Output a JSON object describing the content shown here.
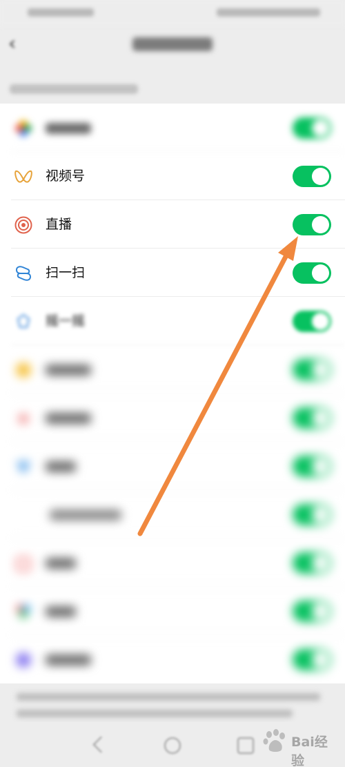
{
  "colors": {
    "toggle_on": "#07c160",
    "arrow": "#f0883e",
    "page_bg": "#ededed",
    "list_bg": "#ffffff"
  },
  "settings_list": [
    {
      "label": "",
      "icon": "moments-icon",
      "enabled": true,
      "blurred": true
    },
    {
      "label": "视频号",
      "icon": "channels-icon",
      "enabled": true,
      "blurred": false
    },
    {
      "label": "直播",
      "icon": "live-icon",
      "enabled": true,
      "blurred": false
    },
    {
      "label": "扫一扫",
      "icon": "scan-icon",
      "enabled": true,
      "blurred": false
    },
    {
      "label": "摇一摇",
      "icon": "shake-icon",
      "enabled": true,
      "blurred": true
    },
    {
      "label": "",
      "icon": "top-stories-icon",
      "enabled": true,
      "blurred": true
    },
    {
      "label": "",
      "icon": "search-icon",
      "enabled": true,
      "blurred": true
    },
    {
      "label": "",
      "icon": "nearby-icon",
      "enabled": true,
      "blurred": true
    },
    {
      "label": "",
      "icon": "people-nearby-icon",
      "enabled": true,
      "blurred": true
    },
    {
      "label": "",
      "icon": "shopping-icon",
      "enabled": true,
      "blurred": true
    },
    {
      "label": "",
      "icon": "games-icon",
      "enabled": true,
      "blurred": true
    },
    {
      "label": "",
      "icon": "mini-programs-icon",
      "enabled": true,
      "blurred": true
    }
  ],
  "watermark": {
    "text": "Bai经验"
  }
}
